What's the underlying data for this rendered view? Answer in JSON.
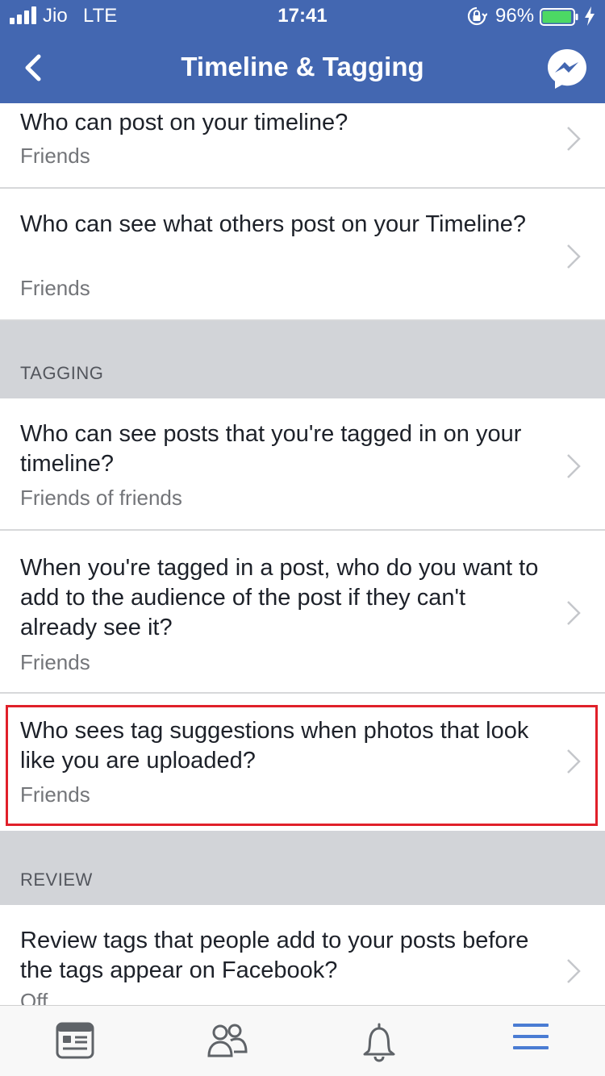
{
  "status_bar": {
    "carrier": "Jio",
    "network": "LTE",
    "time": "17:41",
    "battery_percent": "96%",
    "battery_level": 0.96,
    "icons": [
      "signal-icon",
      "orientation-lock-icon",
      "battery-icon",
      "charging-icon"
    ]
  },
  "nav": {
    "title": "Timeline & Tagging",
    "icons": [
      "back-chevron-icon",
      "messenger-icon"
    ]
  },
  "timeline": {
    "items": [
      {
        "question": "Who can post on your timeline?",
        "value": "Friends"
      },
      {
        "question": "Who can see what others post on your Timeline?",
        "value": "Friends"
      }
    ]
  },
  "tagging": {
    "header": "TAGGING",
    "items": [
      {
        "question": "Who can see posts that you're tagged in on your timeline?",
        "value": "Friends of friends"
      },
      {
        "question": "When you're tagged in a post, who do you want to add to the audience of the post if they can't already see it?",
        "value": "Friends"
      },
      {
        "question": "Who sees tag suggestions when photos that look like you are uploaded?",
        "value": "Friends"
      }
    ]
  },
  "review": {
    "header": "REVIEW",
    "items": [
      {
        "question": "Review tags that people add to your posts before the tags appear on Facebook?",
        "value": "Off"
      }
    ]
  },
  "tabbar": {
    "icons": [
      "news-feed-icon",
      "friends-icon",
      "notifications-bell-icon",
      "menu-icon"
    ],
    "active": "menu-icon"
  },
  "colors": {
    "header_bg": "#4367b1",
    "section_bg": "#d2d4d8",
    "highlight_border": "#e0202a",
    "battery_fill": "#4cd964",
    "tab_active": "#4a7cd3"
  }
}
